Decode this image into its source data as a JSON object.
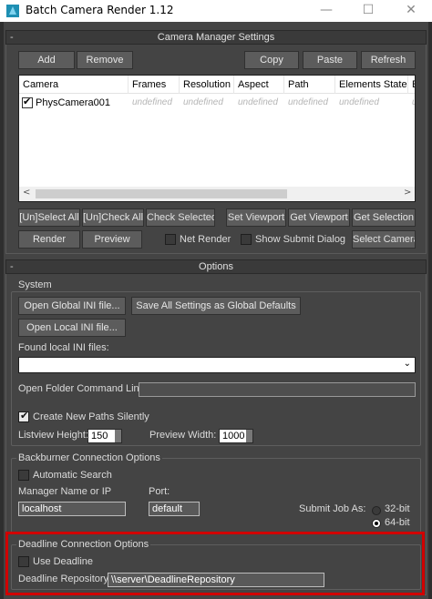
{
  "window": {
    "title": "Batch Camera Render 1.12",
    "controls": {
      "minimize": "—",
      "maximize": "☐",
      "close": "✕"
    }
  },
  "camera_manager": {
    "header": "Camera Manager Settings",
    "collapse": "-",
    "buttons": {
      "add": "Add",
      "remove": "Remove",
      "copy": "Copy",
      "paste": "Paste",
      "refresh": "Refresh"
    },
    "columns": [
      "Camera",
      "Frames",
      "Resolution",
      "Aspect",
      "Path",
      "Elements State",
      "Eleme"
    ],
    "rows": [
      {
        "name": "PhysCamera001",
        "checked": true,
        "frames": "undefined",
        "resolution": "undefined",
        "aspect": "undefined",
        "path": "undefined",
        "elements_state": "undefined",
        "elements": "undefin"
      }
    ],
    "scroll": {
      "left": "<",
      "right": ">"
    },
    "row_buttons": {
      "select_all": "[Un]Select All",
      "check_all": "[Un]Check All",
      "check_selected": "Check Selected",
      "set_viewport": "Set Viewport",
      "get_viewport": "Get Viewport",
      "get_selection": "Get Selection"
    },
    "render": "Render",
    "preview": "Preview",
    "net_render": "Net Render",
    "show_submit_dialog": "Show Submit Dialog",
    "select_camera": "Select Camera"
  },
  "options": {
    "header": "Options",
    "collapse": "-",
    "system": {
      "label": "System",
      "open_global_ini": "Open Global INI file...",
      "save_all_global": "Save All Settings as Global Defaults",
      "open_local_ini": "Open Local INI file...",
      "found_local_label": "Found local INI files:",
      "found_local_value": "",
      "open_folder_label": "Open Folder Command Line:",
      "open_folder_value": "",
      "create_new_paths": "Create New Paths Silently",
      "create_new_paths_checked": true,
      "listview_height_label": "Listview Height:",
      "listview_height_value": "150",
      "preview_width_label": "Preview Width:",
      "preview_width_value": "1000"
    },
    "backburner": {
      "label": "Backburner Connection Options",
      "automatic_search": "Automatic Search",
      "manager_label": "Manager Name or IP",
      "manager_value": "localhost",
      "port_label": "Port:",
      "port_value": "default",
      "submit_job_as": "Submit Job As:",
      "bit32": "32-bit",
      "bit64": "64-bit",
      "selected": "64-bit"
    },
    "deadline": {
      "label": "Deadline Connection Options",
      "use_deadline": "Use Deadline",
      "repository_label": "Deadline Repository:",
      "repository_value": "\\\\server\\DeadlineRepository"
    }
  },
  "colors": {
    "highlight": "#d10000",
    "background": "#444444",
    "titlebar": "#ffffff"
  },
  "icons": {
    "app": "3ds-max-app-icon",
    "checkbox_tick": "✔",
    "combo_arrow": "⌄"
  }
}
